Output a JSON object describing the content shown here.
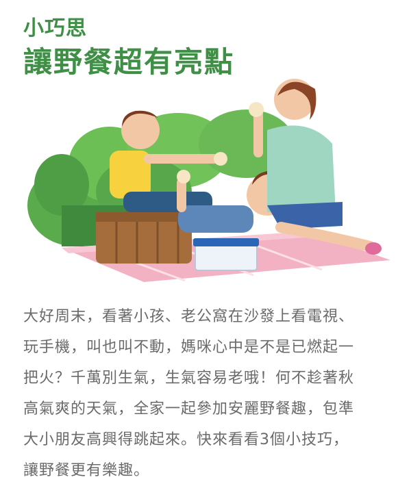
{
  "article": {
    "kicker": "小巧思",
    "title": "讓野餐超有亮點",
    "body_lines": [
      "大好周末，看著小孩、老公窩在沙發上看電視、",
      "玩手機，叫也叫不動，媽咪心中是不是已燃起一",
      "把火？千萬別生氣，生氣容易老哦！何不趁著秋",
      "高氣爽的天氣，全家一起參加安麗野餐趣，包準",
      "大小朋友高興得跳起來。快來看看3個小技巧，",
      "讓野餐更有樂趣。"
    ]
  },
  "colors": {
    "accent_green": "#3f8f46",
    "body_text": "#6a6a6a"
  }
}
